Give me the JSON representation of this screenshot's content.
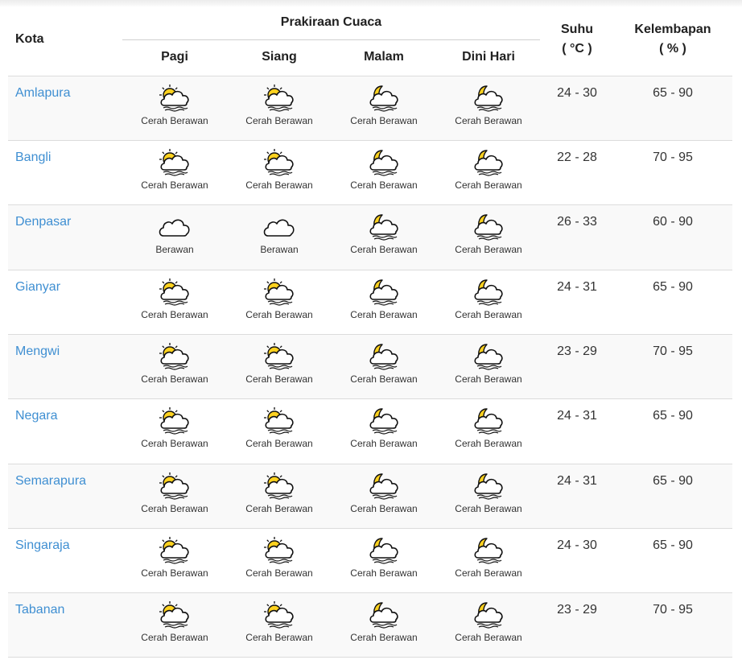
{
  "header": {
    "kota": "Kota",
    "prakiraan": "Prakiraan Cuaca",
    "periods": [
      "Pagi",
      "Siang",
      "Malam",
      "Dini Hari"
    ],
    "suhu": "Suhu",
    "suhu_unit": "( °C )",
    "kelembapan": "Kelembapan",
    "kelembapan_unit": "( % )"
  },
  "colors": {
    "city_link": "#3f8fd2",
    "sun": "#ffd21f",
    "moon": "#ffd21f",
    "row_shade": "#f9f9f9"
  },
  "rows": [
    {
      "city": "Amlapura",
      "icons": [
        "partly-cloudy-day-icon",
        "partly-cloudy-day-icon",
        "partly-cloudy-night-icon",
        "partly-cloudy-night-icon"
      ],
      "labels": [
        "Cerah Berawan",
        "Cerah Berawan",
        "Cerah Berawan",
        "Cerah Berawan"
      ],
      "suhu": "24 - 30",
      "kelembapan": "65 - 90"
    },
    {
      "city": "Bangli",
      "icons": [
        "partly-cloudy-day-icon",
        "partly-cloudy-day-icon",
        "partly-cloudy-night-icon",
        "partly-cloudy-night-icon"
      ],
      "labels": [
        "Cerah Berawan",
        "Cerah Berawan",
        "Cerah Berawan",
        "Cerah Berawan"
      ],
      "suhu": "22 - 28",
      "kelembapan": "70 - 95"
    },
    {
      "city": "Denpasar",
      "icons": [
        "cloud-icon",
        "cloud-icon",
        "partly-cloudy-night-icon",
        "partly-cloudy-night-icon"
      ],
      "labels": [
        "Berawan",
        "Berawan",
        "Cerah Berawan",
        "Cerah Berawan"
      ],
      "suhu": "26 - 33",
      "kelembapan": "60 - 90"
    },
    {
      "city": "Gianyar",
      "icons": [
        "partly-cloudy-day-icon",
        "partly-cloudy-day-icon",
        "partly-cloudy-night-icon",
        "partly-cloudy-night-icon"
      ],
      "labels": [
        "Cerah Berawan",
        "Cerah Berawan",
        "Cerah Berawan",
        "Cerah Berawan"
      ],
      "suhu": "24 - 31",
      "kelembapan": "65 - 90"
    },
    {
      "city": "Mengwi",
      "icons": [
        "partly-cloudy-day-icon",
        "partly-cloudy-day-icon",
        "partly-cloudy-night-icon",
        "partly-cloudy-night-icon"
      ],
      "labels": [
        "Cerah Berawan",
        "Cerah Berawan",
        "Cerah Berawan",
        "Cerah Berawan"
      ],
      "suhu": "23 - 29",
      "kelembapan": "70 - 95"
    },
    {
      "city": "Negara",
      "icons": [
        "partly-cloudy-day-icon",
        "partly-cloudy-day-icon",
        "partly-cloudy-night-icon",
        "partly-cloudy-night-icon"
      ],
      "labels": [
        "Cerah Berawan",
        "Cerah Berawan",
        "Cerah Berawan",
        "Cerah Berawan"
      ],
      "suhu": "24 - 31",
      "kelembapan": "65 - 90"
    },
    {
      "city": "Semarapura",
      "icons": [
        "partly-cloudy-day-icon",
        "partly-cloudy-day-icon",
        "partly-cloudy-night-icon",
        "partly-cloudy-night-icon"
      ],
      "labels": [
        "Cerah Berawan",
        "Cerah Berawan",
        "Cerah Berawan",
        "Cerah Berawan"
      ],
      "suhu": "24 - 31",
      "kelembapan": "65 - 90"
    },
    {
      "city": "Singaraja",
      "icons": [
        "partly-cloudy-day-icon",
        "partly-cloudy-day-icon",
        "partly-cloudy-night-icon",
        "partly-cloudy-night-icon"
      ],
      "labels": [
        "Cerah Berawan",
        "Cerah Berawan",
        "Cerah Berawan",
        "Cerah Berawan"
      ],
      "suhu": "24 - 30",
      "kelembapan": "65 - 90"
    },
    {
      "city": "Tabanan",
      "icons": [
        "partly-cloudy-day-icon",
        "partly-cloudy-day-icon",
        "partly-cloudy-night-icon",
        "partly-cloudy-night-icon"
      ],
      "labels": [
        "Cerah Berawan",
        "Cerah Berawan",
        "Cerah Berawan",
        "Cerah Berawan"
      ],
      "suhu": "23 - 29",
      "kelembapan": "70 - 95"
    }
  ]
}
